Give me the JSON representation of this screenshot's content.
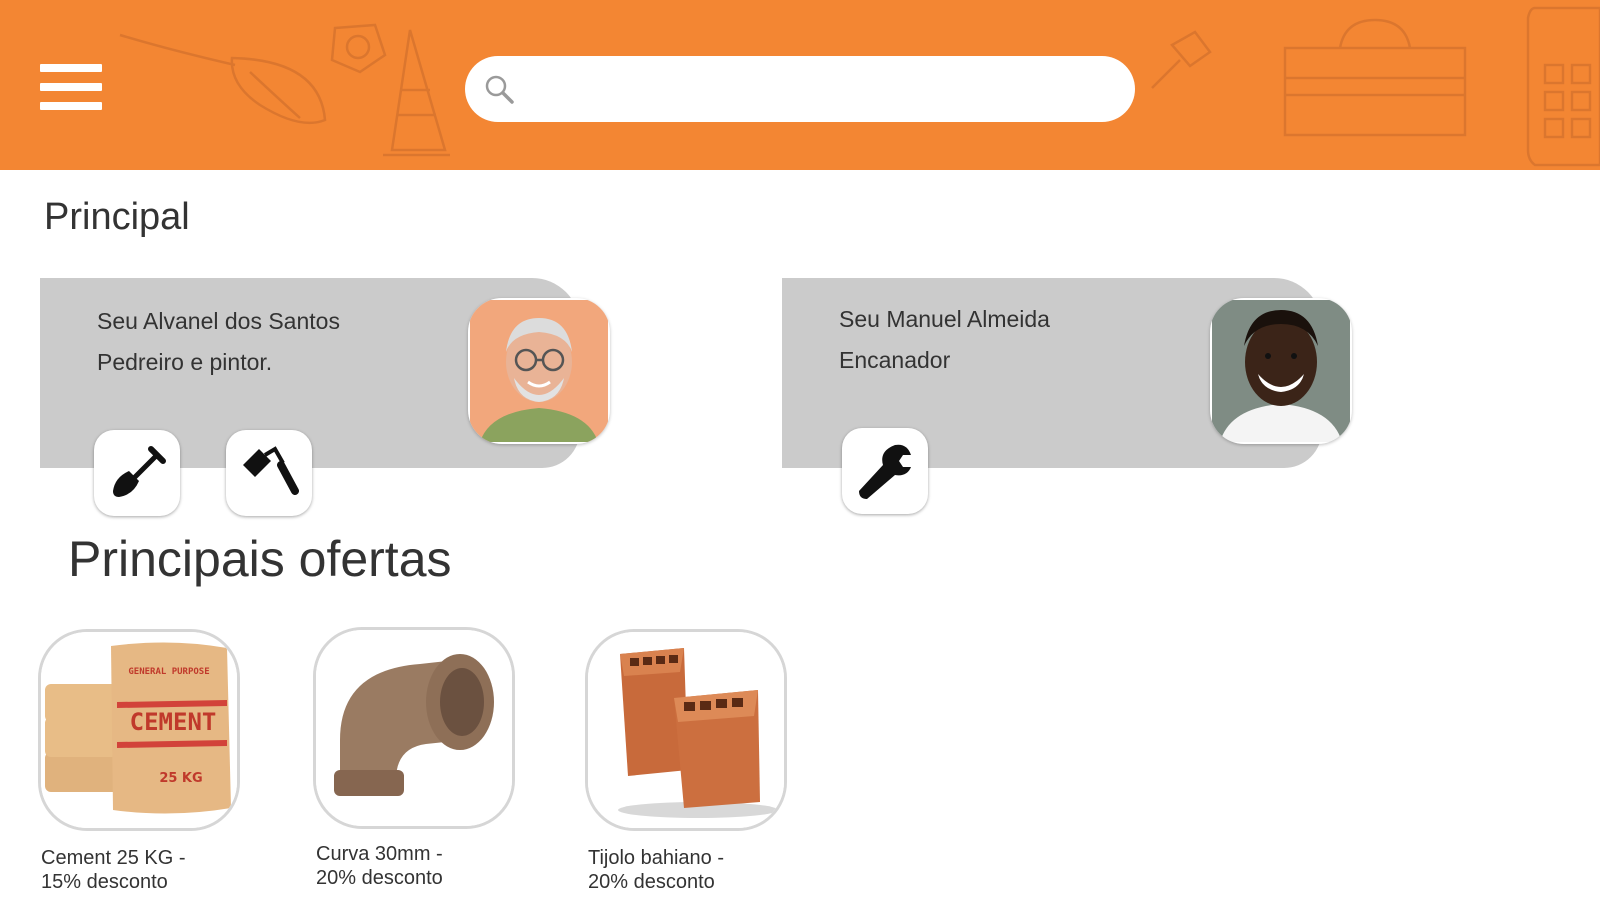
{
  "header": {
    "menu_icon": "hamburger-menu-icon",
    "search": {
      "placeholder": "",
      "value": "",
      "icon": "search-icon"
    },
    "background_color": "#f38633"
  },
  "main": {
    "section_title": "Principal",
    "professionals": [
      {
        "name": "Seu Alvanel dos Santos",
        "role": "Pedreiro e pintor.",
        "tools": [
          "shovel-icon",
          "paint-roller-icon"
        ]
      },
      {
        "name": "Seu Manuel Almeida",
        "role": "Encanador",
        "tools": [
          "wrench-icon"
        ]
      }
    ]
  },
  "offers": {
    "section_title": "Principais ofertas",
    "items": [
      {
        "line1": "Cement 25 KG -",
        "line2": "15% desconto",
        "image": "cement-bag-image"
      },
      {
        "line1": "Curva 30mm -",
        "line2": "20% desconto",
        "image": "pvc-elbow-image"
      },
      {
        "line1": "Tijolo bahiano -",
        "line2": "20% desconto",
        "image": "ceramic-bricks-image"
      }
    ],
    "cement_bag_print": {
      "top": "GENERAL PURPOSE",
      "brand": "CEMENT",
      "weight": "25 KG"
    }
  },
  "colors": {
    "accent": "#f38633",
    "card": "#cbcbcb",
    "text": "#333333"
  }
}
